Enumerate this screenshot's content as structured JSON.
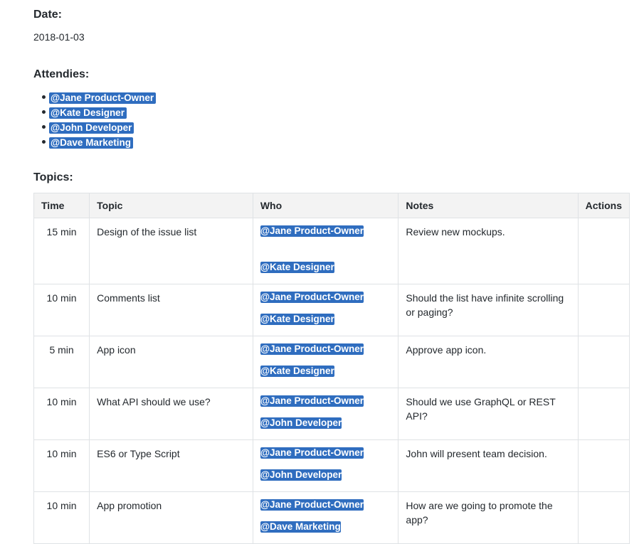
{
  "date": {
    "label": "Date:",
    "value": "2018-01-03"
  },
  "attendees": {
    "label": "Attendies:",
    "items": [
      "@Jane Product-Owner",
      "@Kate Designer",
      "@John Developer",
      "@Dave Marketing"
    ]
  },
  "topics": {
    "label": "Topics:",
    "headers": [
      "Time",
      "Topic",
      "Who",
      "Notes",
      "Actions"
    ],
    "rows": [
      {
        "time": "15 min",
        "topic": "Design of the issue list",
        "who": [
          "@Jane Product-Owner",
          "@Kate Designer"
        ],
        "notes": "Review new mockups.",
        "actions": ""
      },
      {
        "time": "10 min",
        "topic": "Comments list",
        "who": [
          "@Jane Product-Owner",
          "@Kate Designer"
        ],
        "notes": "Should the list have infinite scrolling or paging?",
        "actions": ""
      },
      {
        "time": "5 min",
        "topic": "App icon",
        "who": [
          "@Jane Product-Owner",
          "@Kate Designer"
        ],
        "notes": "Approve app icon.",
        "actions": ""
      },
      {
        "time": "10 min",
        "topic": "What API should we use?",
        "who": [
          "@Jane Product-Owner",
          "@John Developer"
        ],
        "notes": "Should we use GraphQL or REST API?",
        "actions": ""
      },
      {
        "time": "10 min",
        "topic": "ES6 or Type Script",
        "who": [
          "@Jane Product-Owner",
          "@John Developer"
        ],
        "notes": "John will present team decision.",
        "actions": ""
      },
      {
        "time": "10 min",
        "topic": "App promotion",
        "who": [
          "@Jane Product-Owner",
          "@Dave Marketing"
        ],
        "notes": "How are we going to promote the app?",
        "actions": ""
      }
    ]
  },
  "colors": {
    "mention_bg": "#2f6dbf",
    "header_bg": "#f3f3f3",
    "border": "#dfe2e5"
  }
}
